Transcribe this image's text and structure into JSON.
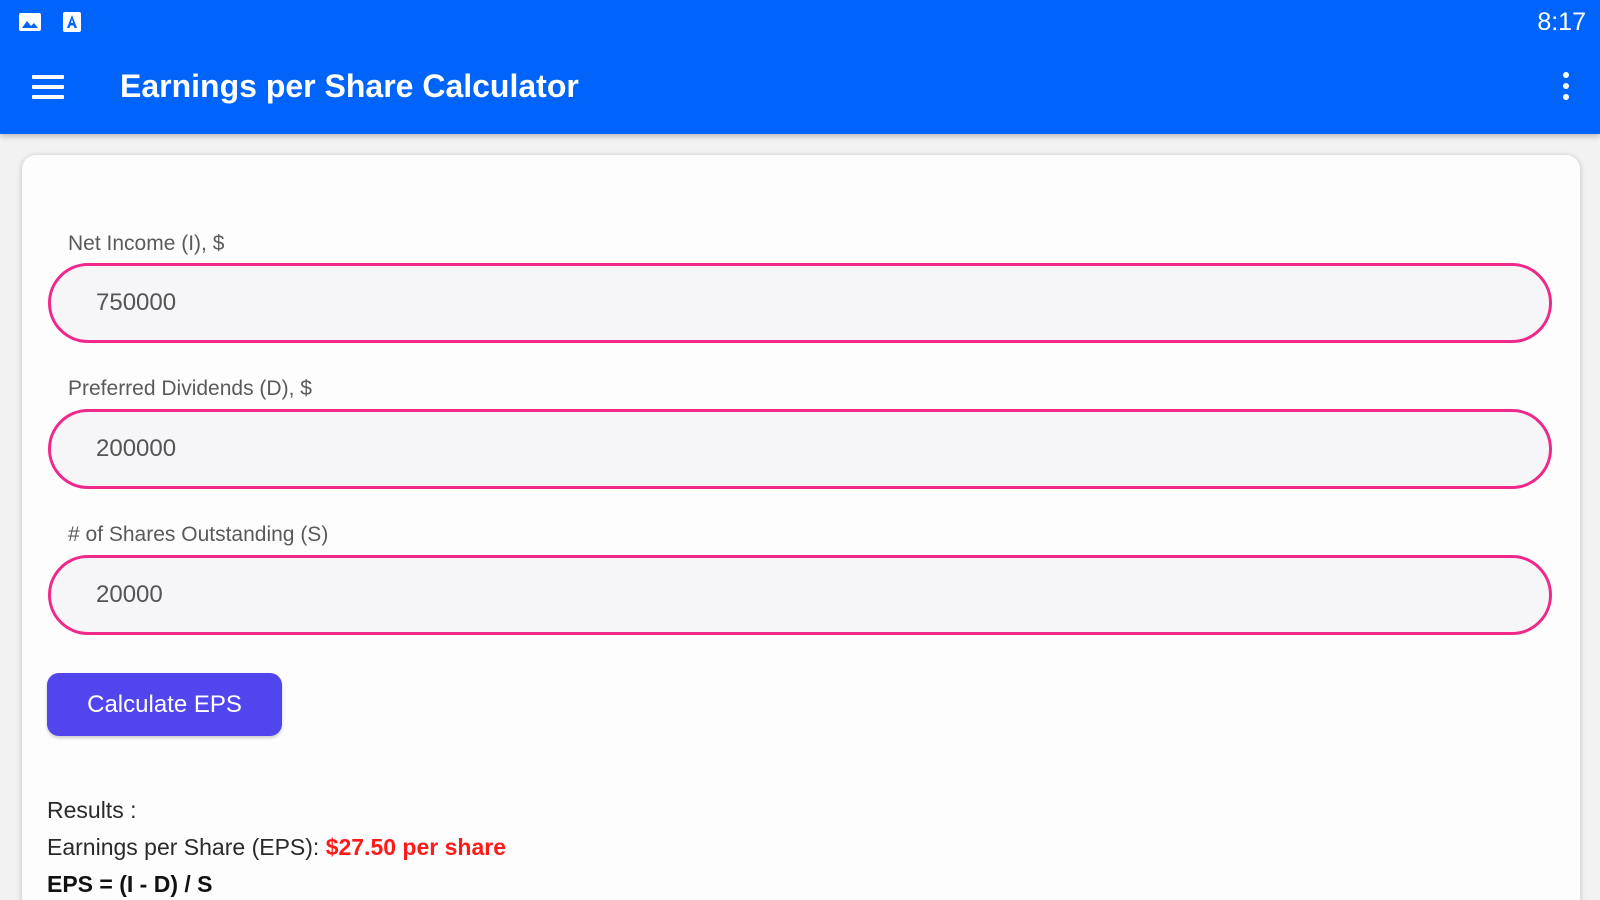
{
  "status_bar": {
    "time": "8:17",
    "icons": [
      "image-icon",
      "font-icon"
    ]
  },
  "app_bar": {
    "title": "Earnings per Share Calculator",
    "menu_icon": "hamburger-menu-icon",
    "overflow_icon": "more-vert-icon"
  },
  "form": {
    "net_income": {
      "label": "Net Income (I), $",
      "value": "750000"
    },
    "preferred_dividends": {
      "label": "Preferred Dividends (D), $",
      "value": "200000"
    },
    "shares_outstanding": {
      "label": "# of Shares Outstanding (S)",
      "value": "20000"
    },
    "calculate_button": "Calculate EPS"
  },
  "results": {
    "heading": "Results :",
    "eps_label": "Earnings per Share (EPS): ",
    "eps_value": "$27.50 per share",
    "formula": "EPS = (I - D) / S"
  },
  "colors": {
    "app_bar": "#0064fa",
    "field_border": "#f0288a",
    "button": "#5145ee",
    "result_highlight": "#ff1a1a"
  }
}
